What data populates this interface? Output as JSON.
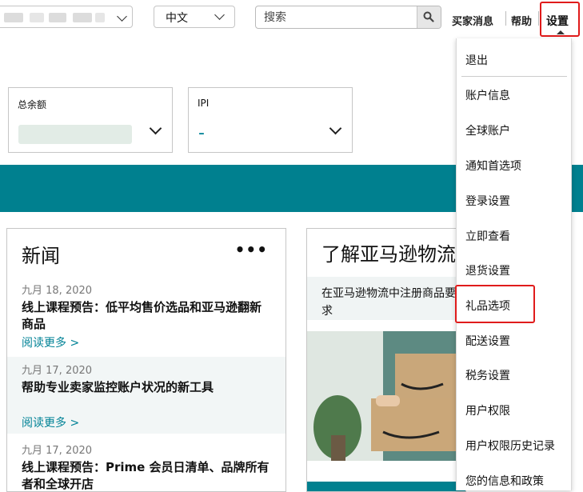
{
  "header": {
    "language": "中文",
    "search_placeholder": "搜索",
    "links": [
      "买家消息",
      "帮助"
    ],
    "settings_label": "设置"
  },
  "cards": [
    {
      "label": "总余额",
      "value": ""
    },
    {
      "label": "IPI",
      "value": "-"
    }
  ],
  "news": {
    "title": "新闻",
    "more": "•••",
    "items": [
      {
        "date": "九月 18, 2020",
        "headline": "线上课程预告：低平均售价选品和亚马逊翻新商品",
        "read_more": "阅读更多 >"
      },
      {
        "date": "九月 17, 2020",
        "headline": "帮助专业卖家监控账户状况的新工具",
        "read_more": "阅读更多 >"
      },
      {
        "date": "九月 17, 2020",
        "headline": "线上课程预告：Prime 会员日清单、品牌所有者和全球开店",
        "read_more": ""
      }
    ]
  },
  "promo": {
    "title": "了解亚马逊物流",
    "desc": "在亚马逊物流中注册商品要求"
  },
  "menu": {
    "items": [
      "退出",
      "账户信息",
      "全球账户",
      "通知首选项",
      "登录设置",
      "立即查看",
      "退货设置",
      "礼品选项",
      "配送设置",
      "税务设置",
      "用户权限",
      "用户权限历史记录",
      "您的信息和政策"
    ]
  },
  "colors": {
    "accent": "#00808f",
    "highlight": "#e01b1b",
    "link": "#008296"
  }
}
